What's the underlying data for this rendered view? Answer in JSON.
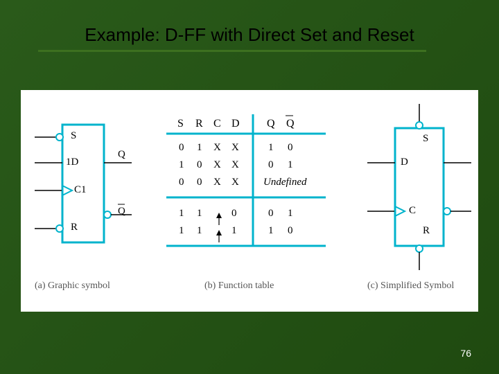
{
  "title": "Example: D-FF with Direct Set and Reset",
  "pagenum": "76",
  "captions": {
    "a": "(a) Graphic symbol",
    "b": "(b) Function table",
    "c": "(c) Simplified Symbol"
  },
  "symbol_a": {
    "s": "S",
    "d": "1D",
    "c": "C1",
    "r": "R",
    "q": "Q",
    "qbar": "Q"
  },
  "symbol_c": {
    "s": "S",
    "d": "D",
    "c": "C",
    "r": "R"
  },
  "table": {
    "hdr": {
      "s": "S",
      "r": "R",
      "c": "C",
      "d": "D",
      "q": "Q",
      "qbar": "Q"
    },
    "rows": [
      {
        "s": "0",
        "r": "1",
        "c": "X",
        "d": "X",
        "q": "1",
        "qbar": "0"
      },
      {
        "s": "1",
        "r": "0",
        "c": "X",
        "d": "X",
        "q": "0",
        "qbar": "1"
      },
      {
        "s": "0",
        "r": "0",
        "c": "X",
        "d": "X",
        "q": "Undefined",
        "qbar": ""
      },
      {
        "s": "1",
        "r": "1",
        "c": "↑",
        "d": "0",
        "q": "0",
        "qbar": "1"
      },
      {
        "s": "1",
        "r": "1",
        "c": "↑",
        "d": "1",
        "q": "1",
        "qbar": "0"
      }
    ]
  }
}
